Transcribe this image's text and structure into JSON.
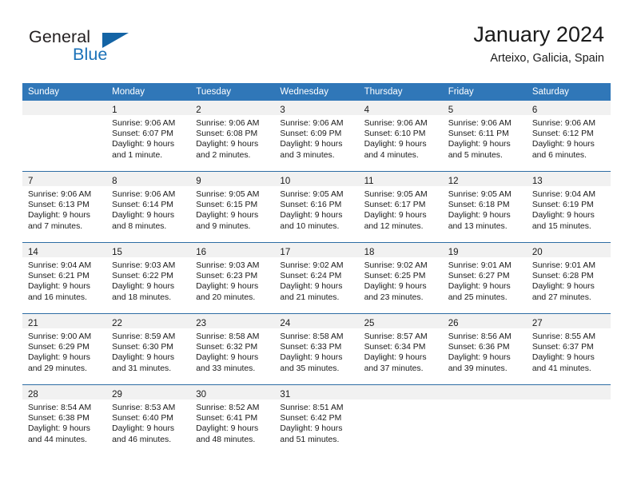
{
  "brand": {
    "name_top": "General",
    "name_bottom": "Blue",
    "triangle_icon": "triangle-icon",
    "accent_color": "#1464a5",
    "text_color": "#231f20"
  },
  "header": {
    "title": "January 2024",
    "subtitle": "Arteixo, Galicia, Spain"
  },
  "theme": {
    "header_bg": "#3077b8",
    "header_text": "#ffffff",
    "daynum_band_bg": "#f1f1f1",
    "row_divider": "#2e6da4",
    "body_text": "#1a1a1a"
  },
  "calendar": {
    "weekday_headers": [
      "Sunday",
      "Monday",
      "Tuesday",
      "Wednesday",
      "Thursday",
      "Friday",
      "Saturday"
    ],
    "weeks": [
      [
        {
          "day": "",
          "lines": []
        },
        {
          "day": "1",
          "lines": [
            "Sunrise: 9:06 AM",
            "Sunset: 6:07 PM",
            "Daylight: 9 hours",
            "and 1 minute."
          ]
        },
        {
          "day": "2",
          "lines": [
            "Sunrise: 9:06 AM",
            "Sunset: 6:08 PM",
            "Daylight: 9 hours",
            "and 2 minutes."
          ]
        },
        {
          "day": "3",
          "lines": [
            "Sunrise: 9:06 AM",
            "Sunset: 6:09 PM",
            "Daylight: 9 hours",
            "and 3 minutes."
          ]
        },
        {
          "day": "4",
          "lines": [
            "Sunrise: 9:06 AM",
            "Sunset: 6:10 PM",
            "Daylight: 9 hours",
            "and 4 minutes."
          ]
        },
        {
          "day": "5",
          "lines": [
            "Sunrise: 9:06 AM",
            "Sunset: 6:11 PM",
            "Daylight: 9 hours",
            "and 5 minutes."
          ]
        },
        {
          "day": "6",
          "lines": [
            "Sunrise: 9:06 AM",
            "Sunset: 6:12 PM",
            "Daylight: 9 hours",
            "and 6 minutes."
          ]
        }
      ],
      [
        {
          "day": "7",
          "lines": [
            "Sunrise: 9:06 AM",
            "Sunset: 6:13 PM",
            "Daylight: 9 hours",
            "and 7 minutes."
          ]
        },
        {
          "day": "8",
          "lines": [
            "Sunrise: 9:06 AM",
            "Sunset: 6:14 PM",
            "Daylight: 9 hours",
            "and 8 minutes."
          ]
        },
        {
          "day": "9",
          "lines": [
            "Sunrise: 9:05 AM",
            "Sunset: 6:15 PM",
            "Daylight: 9 hours",
            "and 9 minutes."
          ]
        },
        {
          "day": "10",
          "lines": [
            "Sunrise: 9:05 AM",
            "Sunset: 6:16 PM",
            "Daylight: 9 hours",
            "and 10 minutes."
          ]
        },
        {
          "day": "11",
          "lines": [
            "Sunrise: 9:05 AM",
            "Sunset: 6:17 PM",
            "Daylight: 9 hours",
            "and 12 minutes."
          ]
        },
        {
          "day": "12",
          "lines": [
            "Sunrise: 9:05 AM",
            "Sunset: 6:18 PM",
            "Daylight: 9 hours",
            "and 13 minutes."
          ]
        },
        {
          "day": "13",
          "lines": [
            "Sunrise: 9:04 AM",
            "Sunset: 6:19 PM",
            "Daylight: 9 hours",
            "and 15 minutes."
          ]
        }
      ],
      [
        {
          "day": "14",
          "lines": [
            "Sunrise: 9:04 AM",
            "Sunset: 6:21 PM",
            "Daylight: 9 hours",
            "and 16 minutes."
          ]
        },
        {
          "day": "15",
          "lines": [
            "Sunrise: 9:03 AM",
            "Sunset: 6:22 PM",
            "Daylight: 9 hours",
            "and 18 minutes."
          ]
        },
        {
          "day": "16",
          "lines": [
            "Sunrise: 9:03 AM",
            "Sunset: 6:23 PM",
            "Daylight: 9 hours",
            "and 20 minutes."
          ]
        },
        {
          "day": "17",
          "lines": [
            "Sunrise: 9:02 AM",
            "Sunset: 6:24 PM",
            "Daylight: 9 hours",
            "and 21 minutes."
          ]
        },
        {
          "day": "18",
          "lines": [
            "Sunrise: 9:02 AM",
            "Sunset: 6:25 PM",
            "Daylight: 9 hours",
            "and 23 minutes."
          ]
        },
        {
          "day": "19",
          "lines": [
            "Sunrise: 9:01 AM",
            "Sunset: 6:27 PM",
            "Daylight: 9 hours",
            "and 25 minutes."
          ]
        },
        {
          "day": "20",
          "lines": [
            "Sunrise: 9:01 AM",
            "Sunset: 6:28 PM",
            "Daylight: 9 hours",
            "and 27 minutes."
          ]
        }
      ],
      [
        {
          "day": "21",
          "lines": [
            "Sunrise: 9:00 AM",
            "Sunset: 6:29 PM",
            "Daylight: 9 hours",
            "and 29 minutes."
          ]
        },
        {
          "day": "22",
          "lines": [
            "Sunrise: 8:59 AM",
            "Sunset: 6:30 PM",
            "Daylight: 9 hours",
            "and 31 minutes."
          ]
        },
        {
          "day": "23",
          "lines": [
            "Sunrise: 8:58 AM",
            "Sunset: 6:32 PM",
            "Daylight: 9 hours",
            "and 33 minutes."
          ]
        },
        {
          "day": "24",
          "lines": [
            "Sunrise: 8:58 AM",
            "Sunset: 6:33 PM",
            "Daylight: 9 hours",
            "and 35 minutes."
          ]
        },
        {
          "day": "25",
          "lines": [
            "Sunrise: 8:57 AM",
            "Sunset: 6:34 PM",
            "Daylight: 9 hours",
            "and 37 minutes."
          ]
        },
        {
          "day": "26",
          "lines": [
            "Sunrise: 8:56 AM",
            "Sunset: 6:36 PM",
            "Daylight: 9 hours",
            "and 39 minutes."
          ]
        },
        {
          "day": "27",
          "lines": [
            "Sunrise: 8:55 AM",
            "Sunset: 6:37 PM",
            "Daylight: 9 hours",
            "and 41 minutes."
          ]
        }
      ],
      [
        {
          "day": "28",
          "lines": [
            "Sunrise: 8:54 AM",
            "Sunset: 6:38 PM",
            "Daylight: 9 hours",
            "and 44 minutes."
          ]
        },
        {
          "day": "29",
          "lines": [
            "Sunrise: 8:53 AM",
            "Sunset: 6:40 PM",
            "Daylight: 9 hours",
            "and 46 minutes."
          ]
        },
        {
          "day": "30",
          "lines": [
            "Sunrise: 8:52 AM",
            "Sunset: 6:41 PM",
            "Daylight: 9 hours",
            "and 48 minutes."
          ]
        },
        {
          "day": "31",
          "lines": [
            "Sunrise: 8:51 AM",
            "Sunset: 6:42 PM",
            "Daylight: 9 hours",
            "and 51 minutes."
          ]
        },
        {
          "day": "",
          "lines": []
        },
        {
          "day": "",
          "lines": []
        },
        {
          "day": "",
          "lines": []
        }
      ]
    ]
  }
}
